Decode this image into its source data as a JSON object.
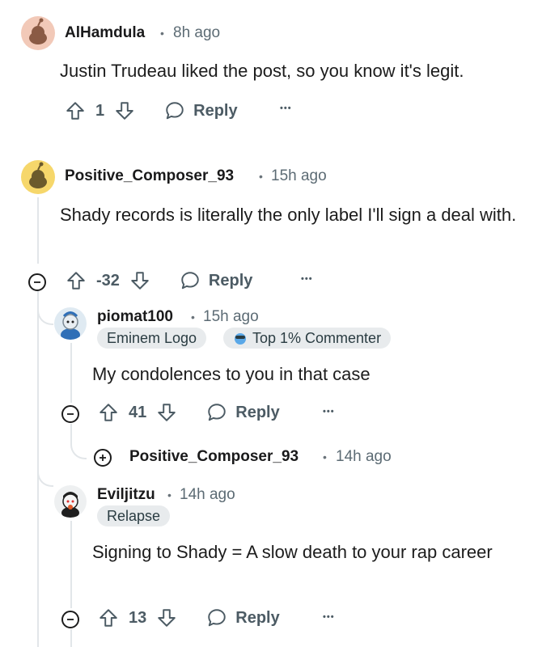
{
  "comments": [
    {
      "username": "AlHamdula",
      "time": "8h ago",
      "body": "Justin Trudeau liked the post, so you know it's legit.",
      "score": "1",
      "reply_label": "Reply",
      "avatar_color": "#f2c9b8"
    },
    {
      "username": "Positive_Composer_93",
      "time": "15h ago",
      "body": "Shady records is literally the only label I'll sign a deal with.",
      "score": "-32",
      "reply_label": "Reply",
      "avatar_color": "#f6d76b"
    },
    {
      "username": "piomat100",
      "time": "15h ago",
      "flairs": [
        "Eminem Logo",
        "Top 1% Commenter"
      ],
      "body": "My condolences to you in that case",
      "score": "41",
      "reply_label": "Reply"
    },
    {
      "username": "Positive_Composer_93",
      "time": "14h ago",
      "collapsed": true
    },
    {
      "username": "Eviljitzu",
      "time": "14h ago",
      "flairs": [
        "Relapse"
      ],
      "body": "Signing to Shady = A slow death to your rap career",
      "score": "13",
      "reply_label": "Reply"
    }
  ],
  "separator": "•",
  "more_label": "•••",
  "colors": {
    "text": "#1c1c1c",
    "meta": "#5c6b74",
    "action": "#4c5b64",
    "flair_bg": "#e8ebed",
    "thread_line": "#e2e6e9"
  }
}
